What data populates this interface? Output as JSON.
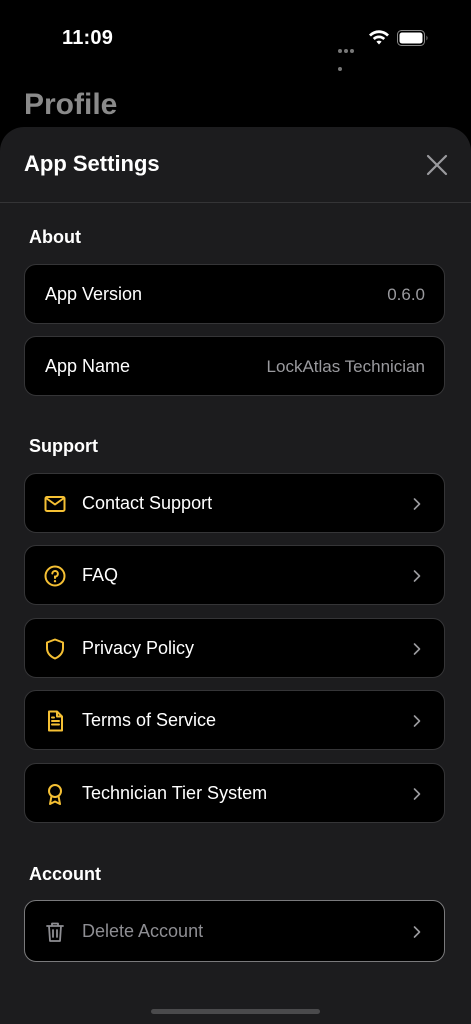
{
  "status_bar": {
    "time": "11:09"
  },
  "background_title": "Profile",
  "sheet": {
    "title": "App Settings",
    "about": {
      "title": "About",
      "items": [
        {
          "label": "App Version",
          "value": "0.6.0"
        },
        {
          "label": "App Name",
          "value": "LockAtlas Technician"
        }
      ]
    },
    "support": {
      "title": "Support",
      "items": [
        {
          "label": "Contact Support",
          "icon": "mail-icon"
        },
        {
          "label": "FAQ",
          "icon": "question-circle-icon"
        },
        {
          "label": "Privacy Policy",
          "icon": "shield-icon"
        },
        {
          "label": "Terms of Service",
          "icon": "document-icon"
        },
        {
          "label": "Technician Tier System",
          "icon": "award-icon"
        }
      ]
    },
    "account": {
      "title": "Account",
      "items": [
        {
          "label": "Delete Account",
          "icon": "trash-icon"
        }
      ]
    }
  },
  "colors": {
    "accent": "#F5C034",
    "sheet_background": "#1C1C1E",
    "row_background": "#000000",
    "muted_text": "#9A9A9E"
  }
}
